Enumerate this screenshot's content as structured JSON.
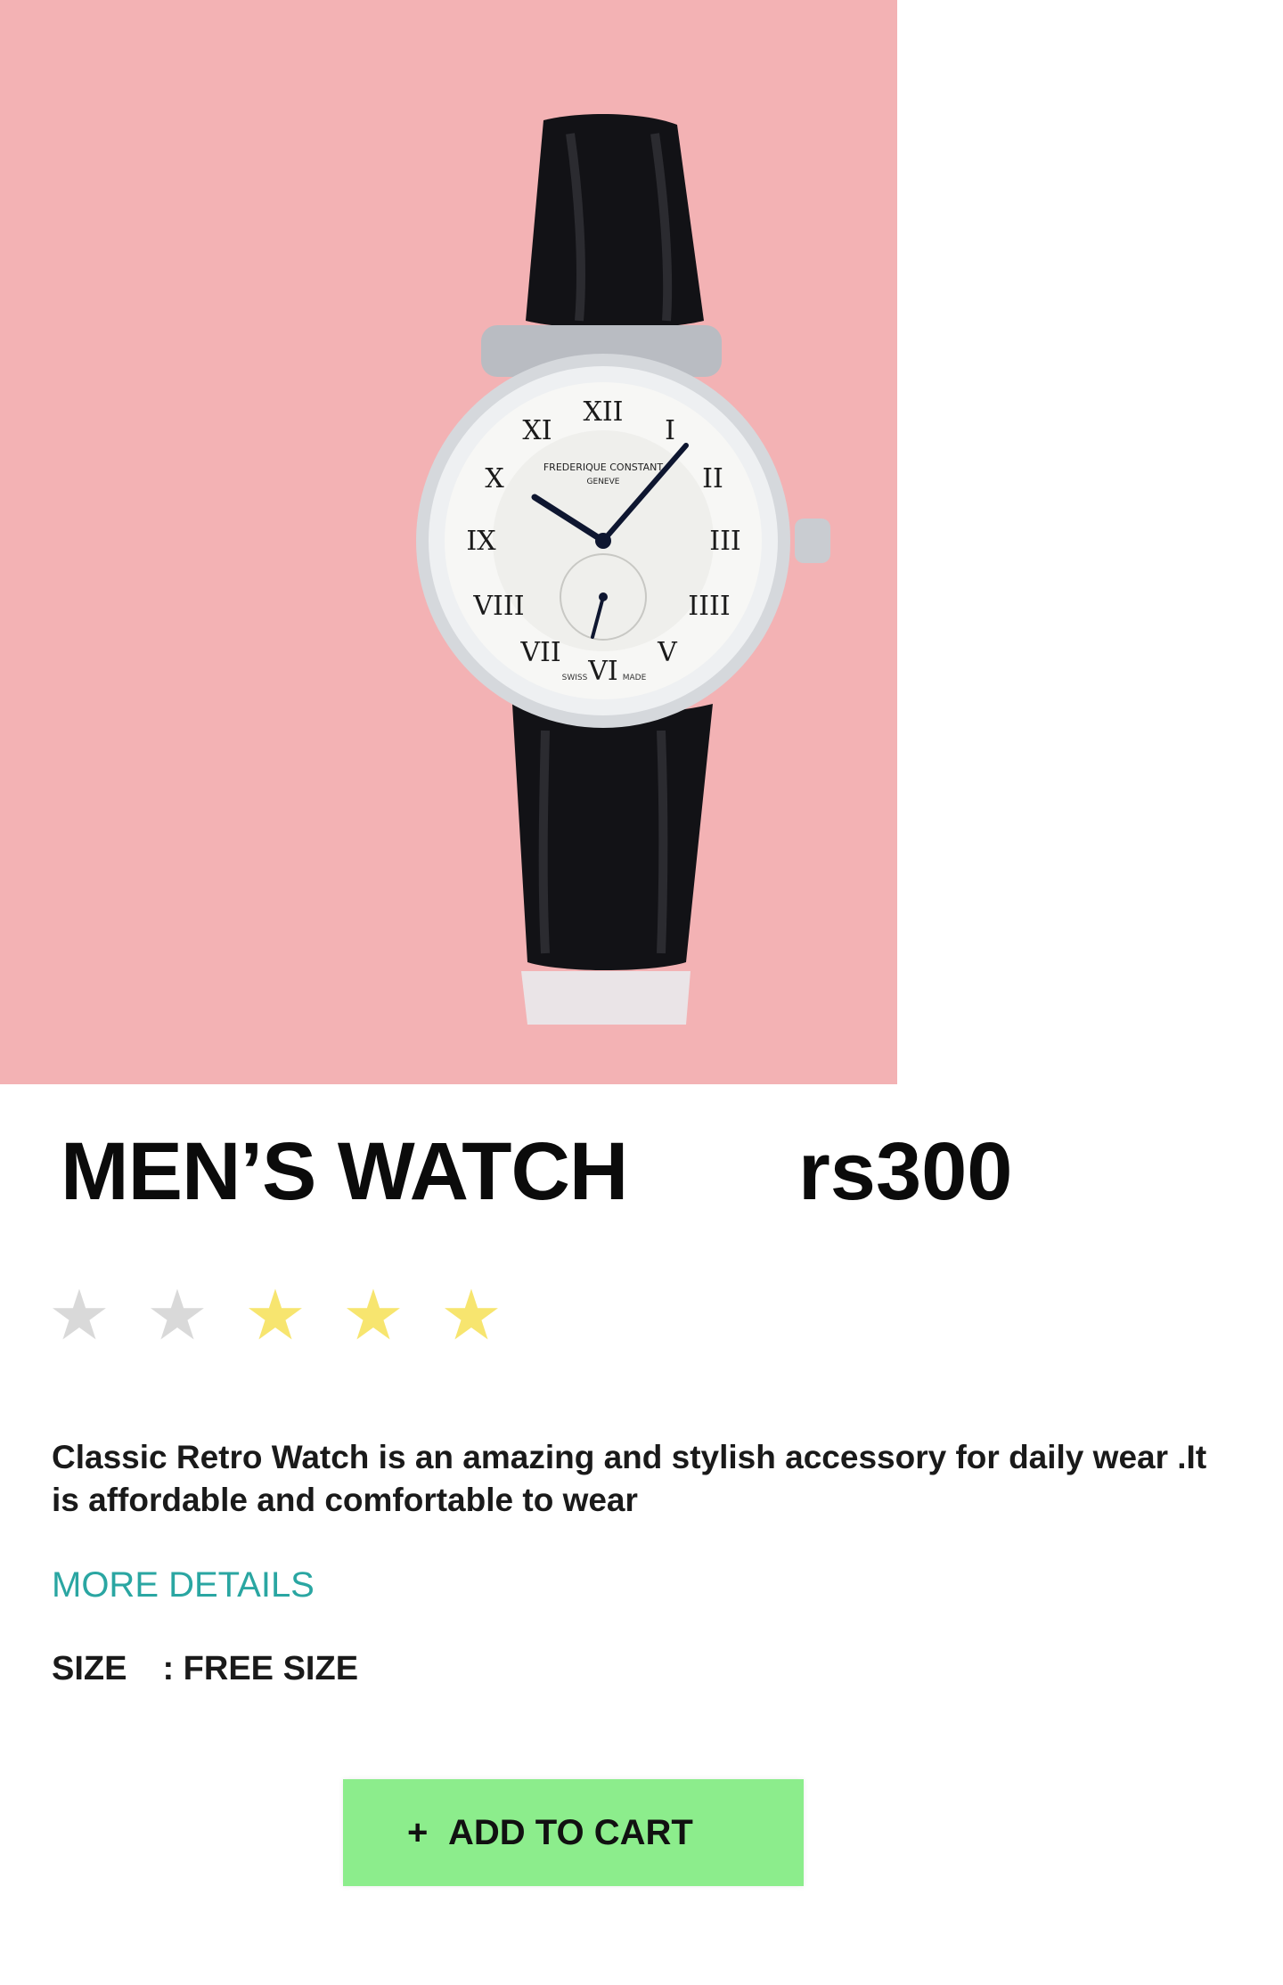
{
  "product": {
    "image_alt": "FREDERIQUE CONSTANT GENEVE",
    "dial_brand": "FREDERIQUE CONSTANT",
    "dial_city": "GENEVE",
    "dial_swiss": "SWISS",
    "dial_made": "MADE",
    "title": "MEN’S WATCH",
    "price": "rs300",
    "rating": 3,
    "rating_max": 5,
    "description": "Classic Retro Watch  is an amazing  and stylish accessory for daily wear .It is affordable and comfortable to wear",
    "more_details_label": "MORE DETAILS",
    "size_label": "SIZE",
    "size_value": ": FREE SIZE"
  },
  "actions": {
    "add_to_cart_icon": "+",
    "add_to_cart_label": "ADD TO CART"
  },
  "colors": {
    "hero_background": "#f3b2b4",
    "star_filled": "#f7e56f",
    "star_empty": "#d9d9d9",
    "more_details": "#2aa6a2",
    "add_to_cart_bg": "#8ced8c"
  }
}
